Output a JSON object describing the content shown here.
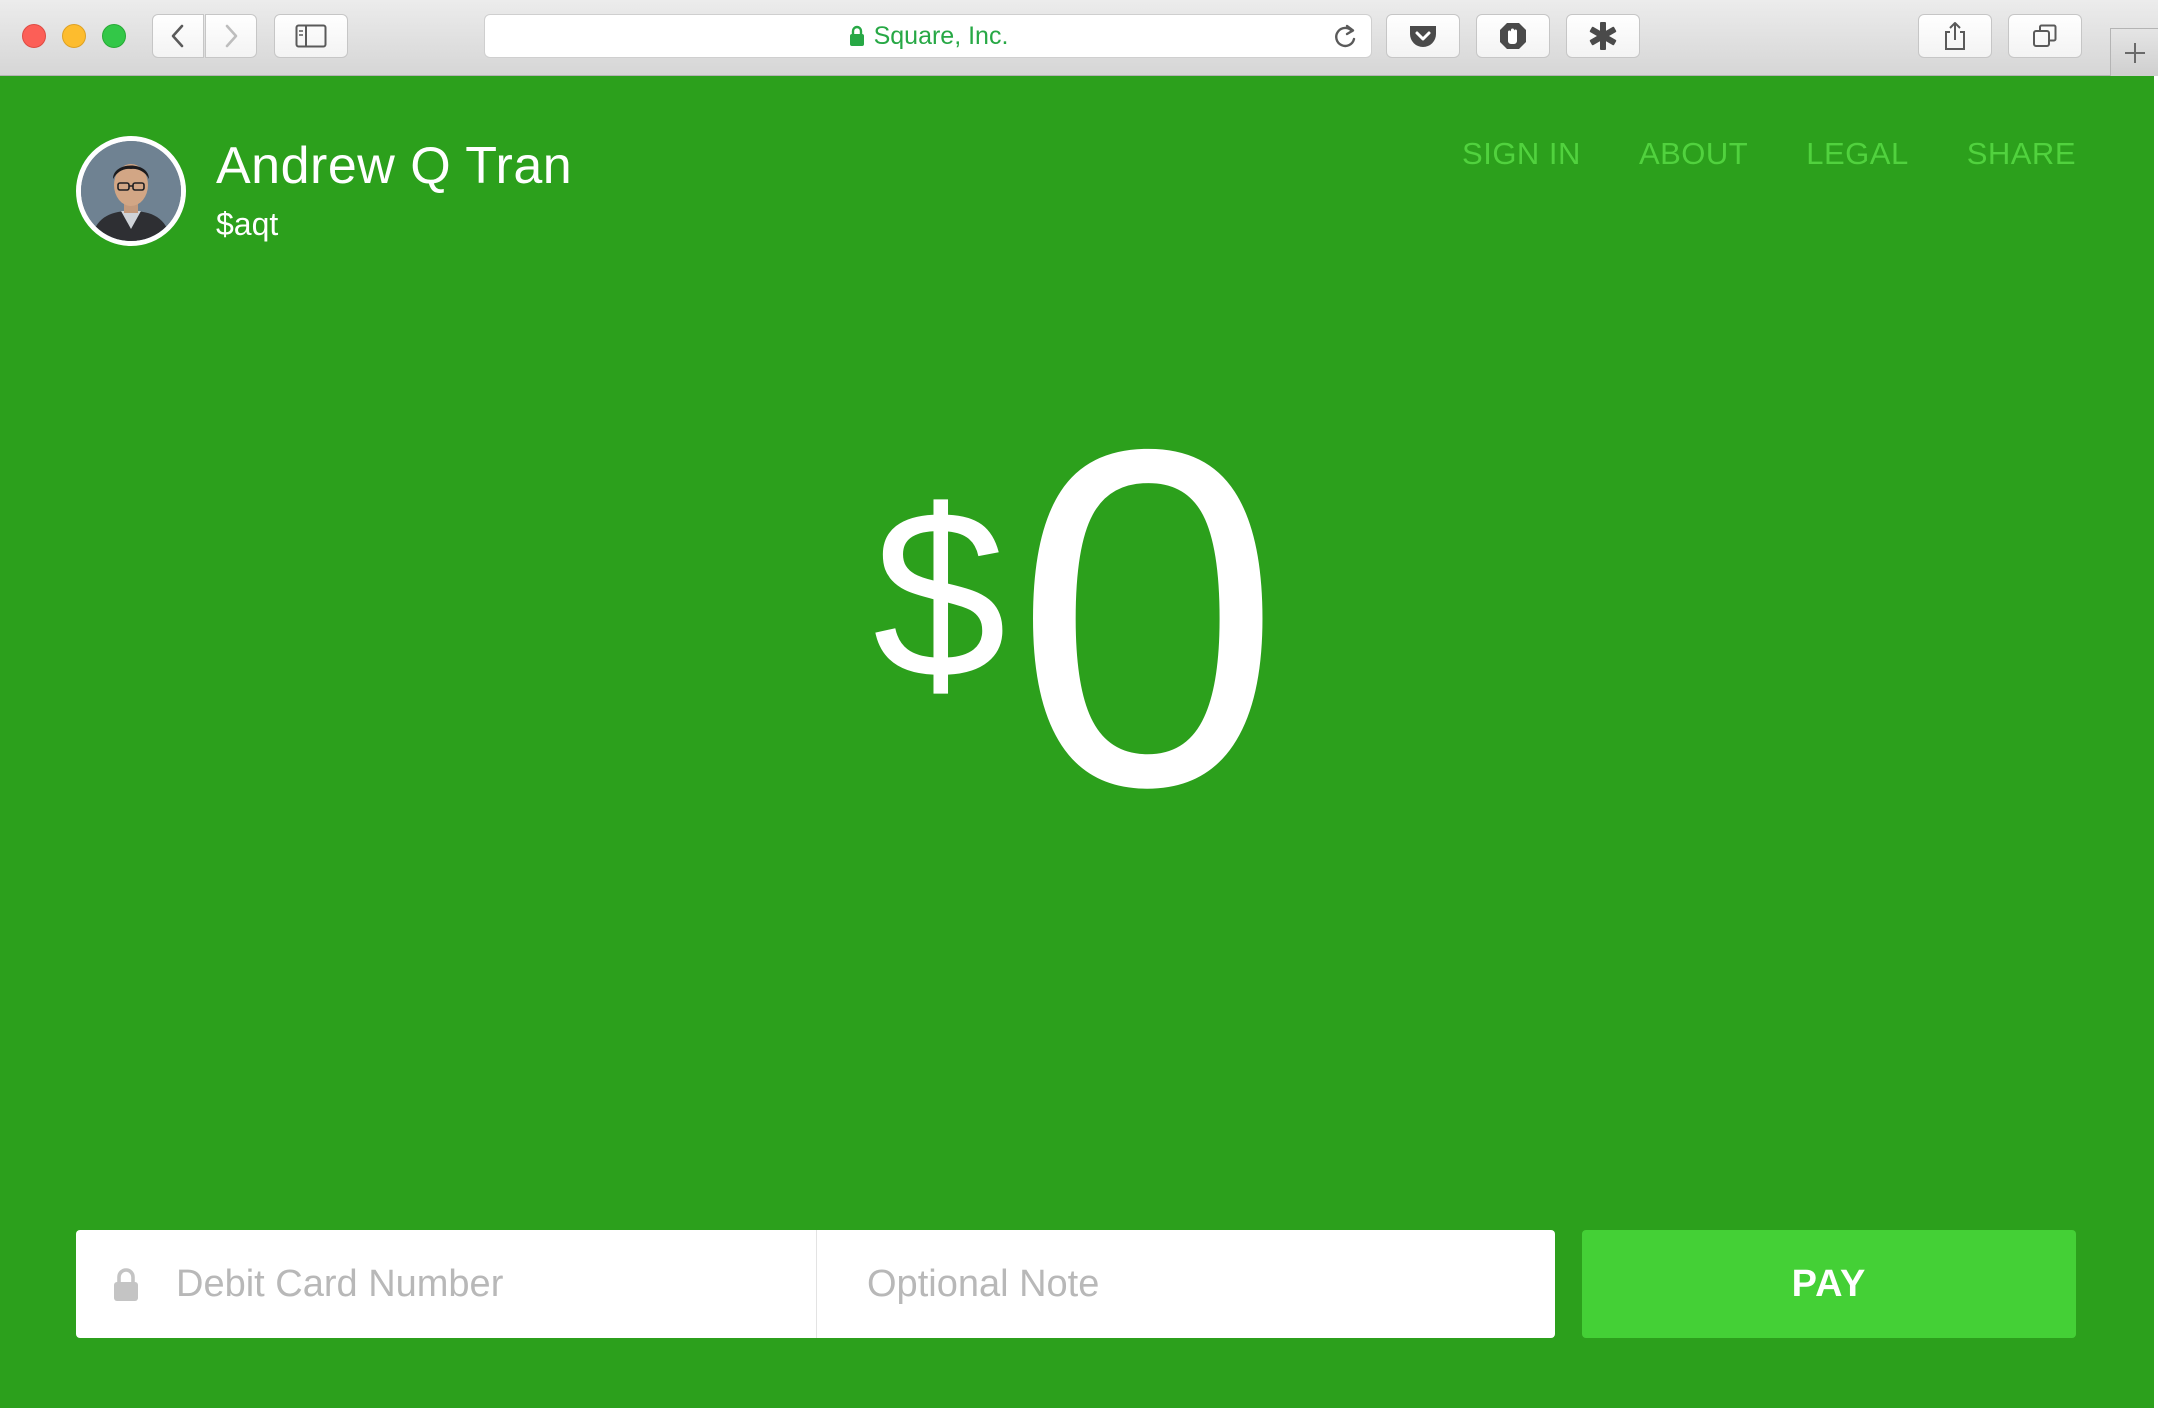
{
  "browser": {
    "url_label": "Square, Inc."
  },
  "profile": {
    "name": "Andrew Q Tran",
    "handle": "$aqt"
  },
  "nav": {
    "items": [
      "SIGN IN",
      "ABOUT",
      "LEGAL",
      "SHARE"
    ]
  },
  "payment": {
    "currency_symbol": "$",
    "amount": "0",
    "card_placeholder": "Debit Card Number",
    "note_placeholder": "Optional Note",
    "pay_label": "PAY"
  },
  "colors": {
    "background": "#2ca01c",
    "nav_link": "#51d23e",
    "pay_button": "#44d036",
    "secure_url": "#27a845"
  },
  "icons": {
    "chrome": [
      "back-icon",
      "forward-icon",
      "sidebar-icon",
      "lock-icon",
      "reload-icon",
      "pocket-icon",
      "adblock-icon",
      "extension-icon",
      "share-icon",
      "tabs-icon",
      "plus-icon"
    ],
    "form": [
      "lock-icon"
    ]
  }
}
